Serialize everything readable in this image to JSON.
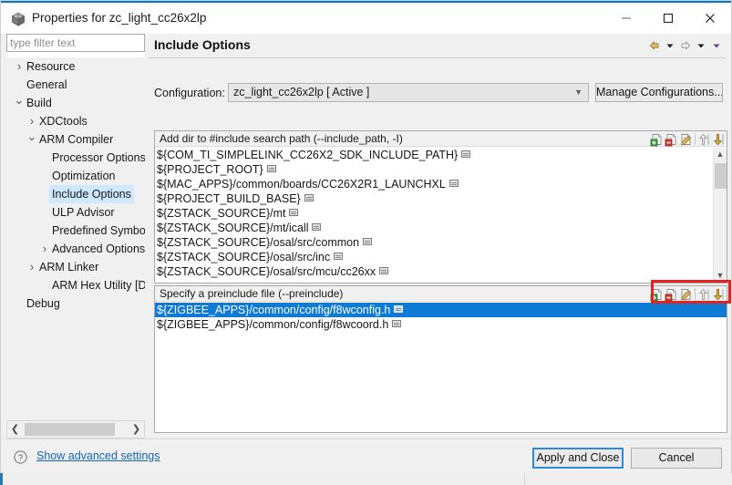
{
  "window": {
    "title": "Properties for zc_light_cc26x2lp",
    "icon": "cube-icon",
    "controls": {
      "minimize": "minimize-icon",
      "maximize": "maximize-icon",
      "close": "close-icon"
    }
  },
  "sidebar": {
    "filter": {
      "value": "",
      "placeholder": "type filter text"
    },
    "items": [
      {
        "label": "Resource",
        "indent": 0,
        "arrow": "collapsed",
        "selected": false
      },
      {
        "label": "General",
        "indent": 0,
        "arrow": "none",
        "selected": false
      },
      {
        "label": "Build",
        "indent": 0,
        "arrow": "expanded",
        "selected": false
      },
      {
        "label": "XDCtools",
        "indent": 1,
        "arrow": "collapsed",
        "selected": false
      },
      {
        "label": "ARM Compiler",
        "indent": 1,
        "arrow": "expanded",
        "selected": false
      },
      {
        "label": "Processor Options",
        "indent": 2,
        "arrow": "none",
        "selected": false
      },
      {
        "label": "Optimization",
        "indent": 2,
        "arrow": "none",
        "selected": false
      },
      {
        "label": "Include Options",
        "indent": 2,
        "arrow": "none",
        "selected": true
      },
      {
        "label": "ULP Advisor",
        "indent": 2,
        "arrow": "none",
        "selected": false
      },
      {
        "label": "Predefined Symbols",
        "indent": 2,
        "arrow": "none",
        "selected": false
      },
      {
        "label": "Advanced Options",
        "indent": 2,
        "arrow": "collapsed",
        "selected": false
      },
      {
        "label": "ARM Linker",
        "indent": 1,
        "arrow": "collapsed",
        "selected": false
      },
      {
        "label": "ARM Hex Utility  [Disa",
        "indent": 2,
        "arrow": "none",
        "selected": false
      },
      {
        "label": "Debug",
        "indent": 0,
        "arrow": "none",
        "selected": false
      }
    ],
    "scrollbar": {
      "left_arrow": "chevron-left-icon",
      "right_arrow": "chevron-right-icon"
    }
  },
  "content": {
    "page_title": "Include Options",
    "nav": [
      {
        "name": "back-icon",
        "kind": "arrow-left-gold"
      },
      {
        "name": "back-dropdown-icon",
        "kind": "caret-black"
      },
      {
        "name": "forward-icon",
        "kind": "arrow-right-gray"
      },
      {
        "name": "forward-dropdown-icon",
        "kind": "caret-black"
      },
      {
        "name": "view-menu-icon",
        "kind": "caret-purple"
      }
    ],
    "configuration": {
      "label": "Configuration:",
      "value": "zc_light_cc26x2lp  [ Active ]",
      "manage_button": "Manage Configurations..."
    },
    "include_paths": {
      "title": "Add dir to #include search path (--include_path, -I)",
      "tools": [
        {
          "name": "add-icon",
          "kind": "add"
        },
        {
          "name": "delete-icon",
          "kind": "delete"
        },
        {
          "name": "edit-icon",
          "kind": "edit"
        },
        {
          "name": "move-up-icon",
          "kind": "up"
        },
        {
          "name": "move-down-icon",
          "kind": "down"
        }
      ],
      "rows": [
        "${COM_TI_SIMPLELINK_CC26X2_SDK_INCLUDE_PATH}",
        "${PROJECT_ROOT}",
        "${MAC_APPS}/common/boards/CC26X2R1_LAUNCHXL",
        "${PROJECT_BUILD_BASE}",
        "${ZSTACK_SOURCE}/mt",
        "${ZSTACK_SOURCE}/mt/icall",
        "${ZSTACK_SOURCE}/osal/src/common",
        "${ZSTACK_SOURCE}/osal/src/inc",
        "${ZSTACK_SOURCE}/osal/src/mcu/cc26xx"
      ],
      "scrollbar": {
        "up": "scroll-up-icon",
        "down": "scroll-down-icon"
      }
    },
    "preinclude": {
      "title": "Specify a preinclude file (--preinclude)",
      "tools": [
        {
          "name": "add-icon",
          "kind": "add"
        },
        {
          "name": "delete-icon",
          "kind": "delete"
        },
        {
          "name": "edit-icon",
          "kind": "edit"
        },
        {
          "name": "move-up-icon",
          "kind": "up"
        },
        {
          "name": "move-down-icon",
          "kind": "down"
        }
      ],
      "rows": [
        "${ZIGBEE_APPS}/common/config/f8wconfig.h",
        "${ZIGBEE_APPS}/common/config/f8wcoord.h"
      ],
      "selected_index": 0,
      "highlight_color": "#e52020"
    }
  },
  "footer": {
    "help_icon": "question-mark-icon",
    "advanced_link": "Show advanced settings",
    "apply_button": "Apply and Close",
    "cancel_button": "Cancel"
  },
  "colors": {
    "accent": "#0078d7",
    "selection": "#0e7ad4",
    "tree_selection": "#cde8ff",
    "highlight": "#e52020",
    "link": "#1464b4"
  }
}
